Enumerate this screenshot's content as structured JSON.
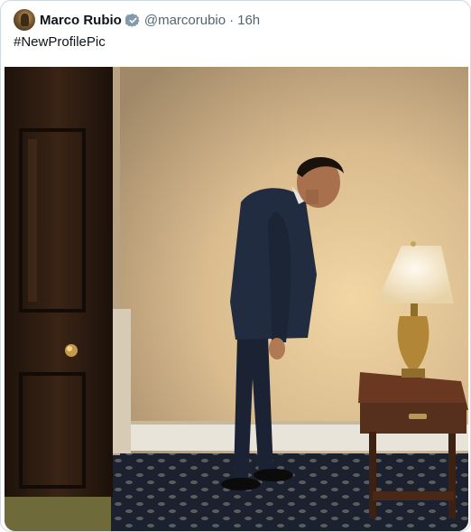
{
  "tweet": {
    "author_name": "Marco Rubio",
    "handle": "@marcorubio",
    "separator": "·",
    "time": "16h",
    "text": "#NewProfilePic",
    "verified_color": "#829aab"
  },
  "icons": {
    "avatar": "profile-avatar",
    "verified": "verified-badge-icon"
  }
}
